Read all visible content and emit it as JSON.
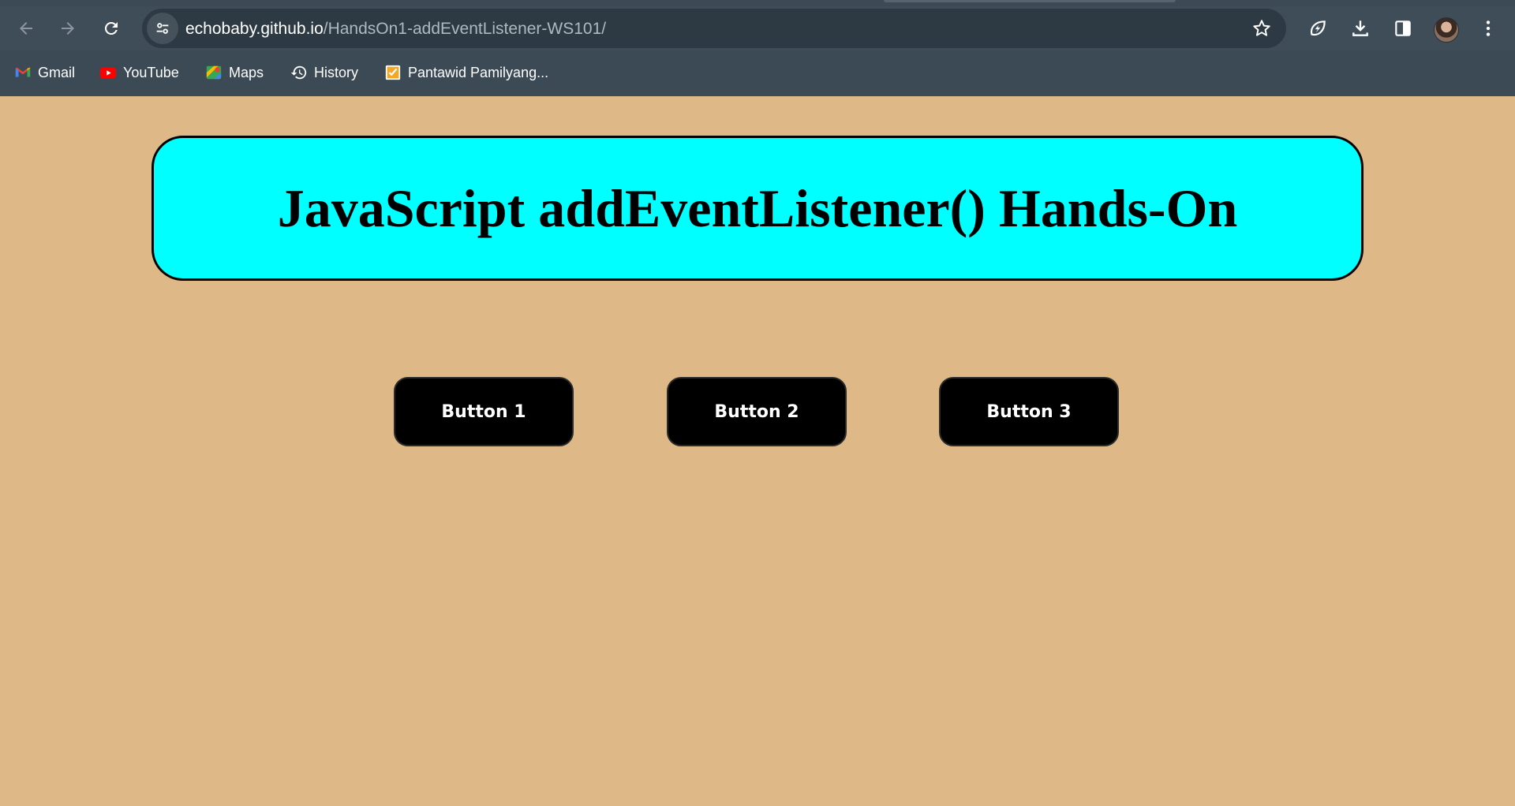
{
  "browser": {
    "url_host": "echobaby.github.io",
    "url_path": "/HandsOn1-addEventListener-WS101/",
    "icons": {
      "back": "arrow-left-icon",
      "forward": "arrow-right-icon",
      "reload": "reload-icon",
      "site_info": "tune-icon",
      "bookmark": "star-icon",
      "performance": "leaf-bolt-icon",
      "downloads": "download-icon",
      "side_panel": "side-panel-icon",
      "menu": "kebab-menu-icon"
    },
    "bookmarks": [
      {
        "label": "Gmail",
        "icon": "gmail-icon"
      },
      {
        "label": "YouTube",
        "icon": "youtube-icon"
      },
      {
        "label": "Maps",
        "icon": "maps-icon"
      },
      {
        "label": "History",
        "icon": "history-icon"
      },
      {
        "label": "Pantawid Pamilyang...",
        "icon": "checklist-icon"
      }
    ]
  },
  "page": {
    "heading": "JavaScript addEventListener() Hands-On",
    "background_color": "#deb887",
    "heading_bg_color": "#00ffff",
    "buttons": [
      {
        "label": "Button 1"
      },
      {
        "label": "Button 2"
      },
      {
        "label": "Button 3"
      }
    ]
  }
}
